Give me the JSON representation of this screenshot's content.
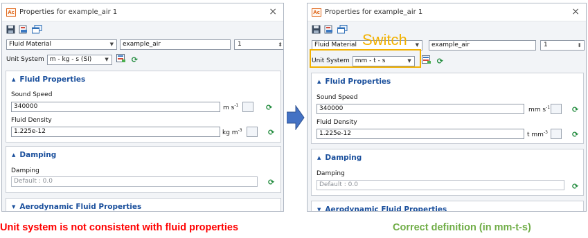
{
  "colors": {
    "accent_blue": "#1a4f9c",
    "switch_yellow": "#f2b100",
    "error_red": "#ff0000",
    "ok_green": "#70ad47",
    "arrow_blue": "#4472c4"
  },
  "left": {
    "title": "Properties for example_air 1",
    "close_label": "×",
    "material_type": "Fluid Material",
    "material_name": "example_air",
    "material_index": "1",
    "unit_system_label": "Unit System",
    "unit_system_value": "m - kg - s (SI)",
    "fluid_section": "Fluid Properties",
    "sound_speed_label": "Sound Speed",
    "sound_speed_value": "340000",
    "sound_speed_unit_base": "m s",
    "sound_speed_unit_exp": "-1",
    "density_label": "Fluid Density",
    "density_value": "1.225e-12",
    "density_unit_base": "kg m",
    "density_unit_exp": "-3",
    "damping_section": "Damping",
    "damping_label": "Damping",
    "damping_placeholder": "Default : 0.0",
    "aero_section": "Aerodynamic Fluid Properties"
  },
  "right": {
    "title": "Properties for example_air 1",
    "close_label": "×",
    "material_type": "Fluid Material",
    "material_name": "example_air",
    "material_index": "1",
    "unit_system_label": "Unit System",
    "unit_system_value": "mm - t - s",
    "fluid_section": "Fluid Properties",
    "sound_speed_label": "Sound Speed",
    "sound_speed_value": "340000",
    "sound_speed_unit_base": "mm s",
    "sound_speed_unit_exp": "-1",
    "density_label": "Fluid Density",
    "density_value": "1.225e-12",
    "density_unit_base": "t mm",
    "density_unit_exp": "-3",
    "damping_section": "Damping",
    "damping_label": "Damping",
    "damping_placeholder": "Default : 0.0",
    "aero_section": "Aerodynamic Fluid Properties"
  },
  "annotations": {
    "switch_label": "Switch",
    "left_caption": "Unit system is not consistent with fluid properties",
    "right_caption": "Correct definition (in mm-t-s)"
  }
}
